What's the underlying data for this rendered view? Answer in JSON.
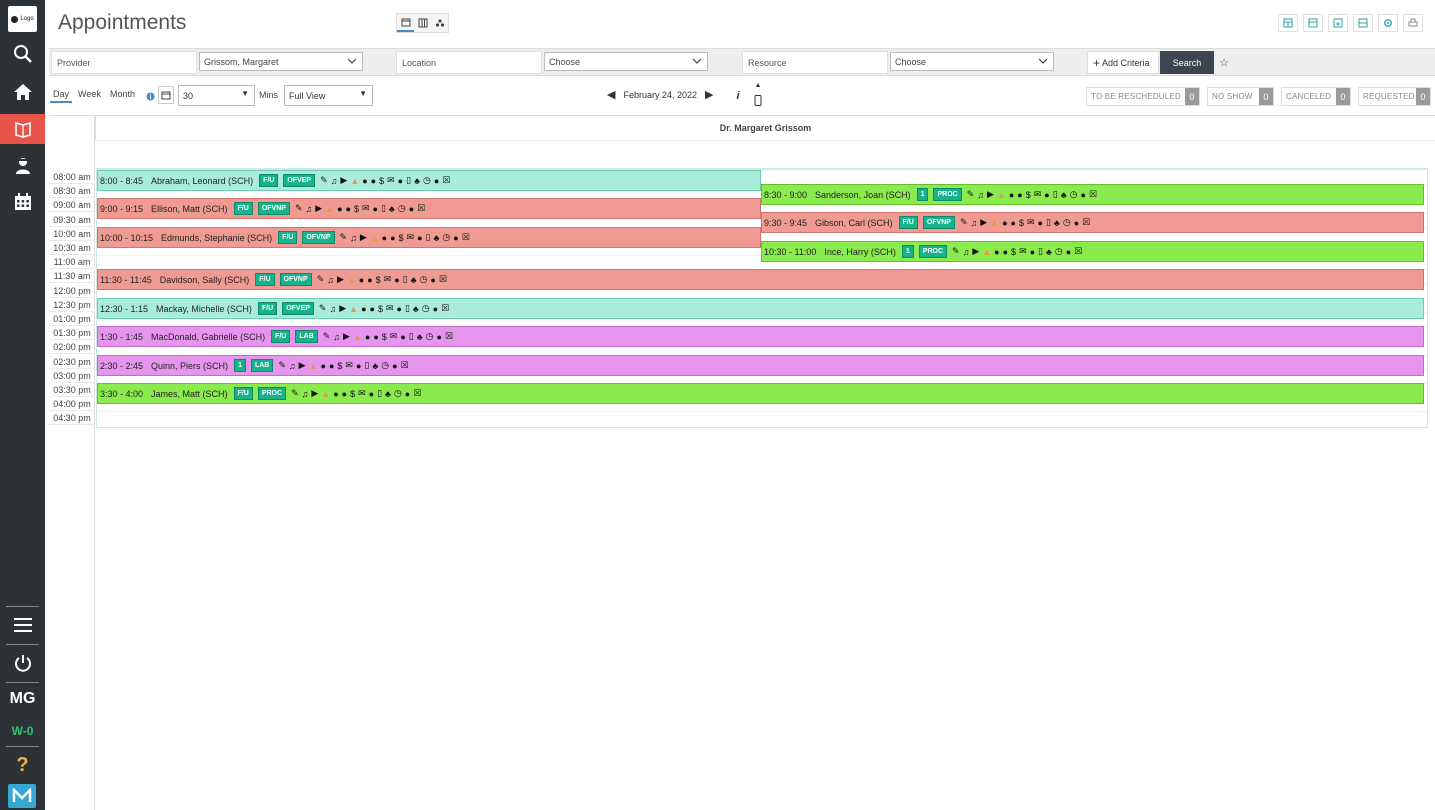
{
  "sidebar": {
    "logo_text": "Logo",
    "user_initials": "MG",
    "workstation": "W-0",
    "colors": {
      "bg": "#2d3237",
      "active": "#e8534a",
      "workstation": "#2fc56e"
    }
  },
  "header": {
    "title": "Appointments"
  },
  "criteria": {
    "provider_label": "Provider",
    "provider_value": "Grissom, Margaret",
    "location_label": "Location",
    "location_value": "Choose",
    "resource_label": "Resource",
    "resource_value": "Choose",
    "add_criteria": "Add Criteria",
    "search": "Search"
  },
  "toolbar": {
    "tabs": [
      "Day",
      "Week",
      "Month"
    ],
    "interval_value": "30",
    "mins_label": "Mins",
    "view_value": "Full View",
    "date": "February 24, 2022",
    "statuses": [
      {
        "label": "TO BE RESCHEDULED",
        "count": "0"
      },
      {
        "label": "NO SHOW",
        "count": "0"
      },
      {
        "label": "CANCELED",
        "count": "0"
      },
      {
        "label": "REQUESTED",
        "count": "0"
      }
    ]
  },
  "calendar": {
    "column_title": "Dr. Margaret Grissom",
    "times": [
      "08:00 am",
      "08:30 am",
      "09:00 am",
      "09:30 am",
      "10:00 am",
      "10:30 am",
      "11:00 am",
      "11:30 am",
      "12:00 pm",
      "12:30 pm",
      "01:00 pm",
      "01:30 pm",
      "02:00 pm",
      "02:30 pm",
      "03:00 pm",
      "03:30 pm",
      "04:00 pm",
      "04:30 pm"
    ],
    "colors": {
      "teal": "#a9ecd9",
      "red": "#ef9a92",
      "purple": "#e596ec",
      "green": "#8aea4e"
    },
    "appointments": [
      {
        "time": "8:00 - 8:45",
        "name": "Abraham, Leonard (SCH)",
        "badge1": "F/U",
        "badge2": "OFVEP",
        "color": "teal"
      },
      {
        "time": "9:00 - 9:15",
        "name": "Ellison, Matt (SCH)",
        "badge1": "F/U",
        "badge2": "OFVNP",
        "color": "red"
      },
      {
        "time": "10:00 - 10:15",
        "name": "Edmunds, Stephanie (SCH)",
        "badge1": "F/U",
        "badge2": "OFVNP",
        "color": "red"
      },
      {
        "time": "8:30 - 9:00",
        "name": "Sanderson, Joan (SCH)",
        "badge1": "1",
        "badge2": "PROC",
        "color": "green"
      },
      {
        "time": "9:30 - 9:45",
        "name": "Gibson, Carl (SCH)",
        "badge1": "F/U",
        "badge2": "OFVNP",
        "color": "red"
      },
      {
        "time": "10:30 - 11:00",
        "name": "Ince, Harry (SCH)",
        "badge1": "1",
        "badge2": "PROC",
        "color": "green"
      },
      {
        "time": "11:30 - 11:45",
        "name": "Davidson, Sally (SCH)",
        "badge1": "F/U",
        "badge2": "OFVNP",
        "color": "red"
      },
      {
        "time": "12:30 - 1:15",
        "name": "Mackay, Michelle (SCH)",
        "badge1": "F/U",
        "badge2": "OFVEP",
        "color": "teal"
      },
      {
        "time": "1:30 - 1:45",
        "name": "MacDonald, Gabrielle (SCH)",
        "badge1": "F/U",
        "badge2": "LAB",
        "color": "purple"
      },
      {
        "time": "2:30 - 2:45",
        "name": "Quinn, Piers (SCH)",
        "badge1": "1",
        "badge2": "LAB",
        "color": "purple"
      },
      {
        "time": "3:30 - 4:00",
        "name": "James, Matt (SCH)",
        "badge1": "F/U",
        "badge2": "PROC",
        "color": "green"
      }
    ]
  }
}
